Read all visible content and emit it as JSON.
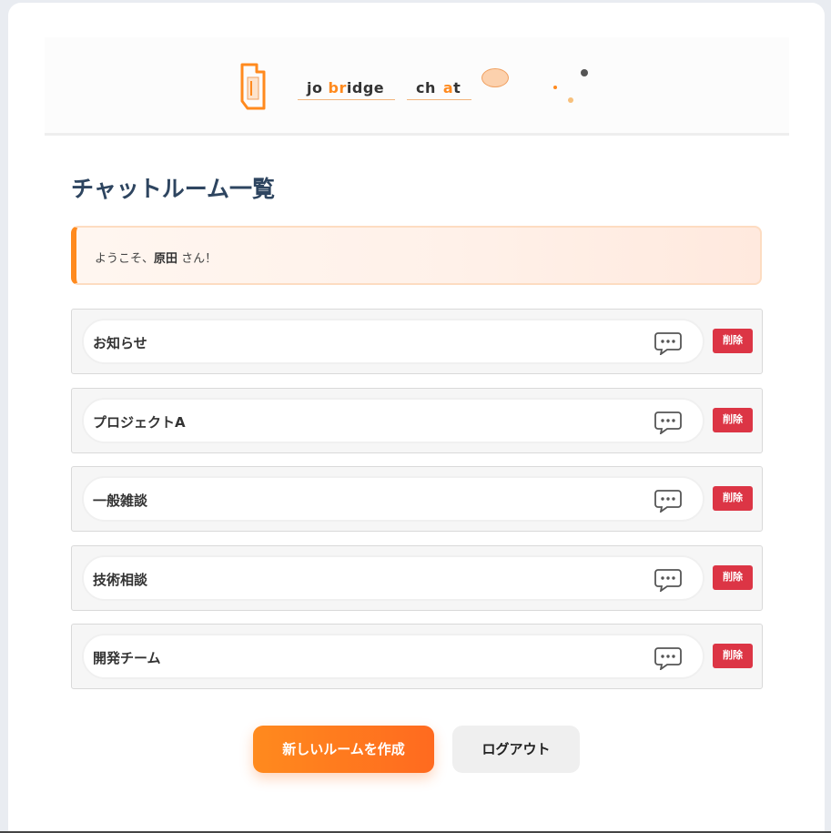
{
  "header": {
    "logo_parts": [
      "jo ",
      "br",
      "idge",
      "ch",
      "a",
      "t"
    ],
    "colors": {
      "accent": "#ff8a1e",
      "text": "#333333"
    }
  },
  "page_title": "チャットルーム一覧",
  "welcome": {
    "prefix": "ようこそ、",
    "user": "原田",
    "suffix": " さん！"
  },
  "rooms": [
    {
      "name": "お知らせ",
      "icon": "chat-bubble-icon",
      "delete_label": "削除"
    },
    {
      "name": "プロジェクトA",
      "icon": "chat-bubble-icon",
      "delete_label": "削除"
    },
    {
      "name": "一般雑談",
      "icon": "chat-bubble-icon",
      "delete_label": "削除"
    },
    {
      "name": "技術相談",
      "icon": "chat-bubble-icon",
      "delete_label": "削除"
    },
    {
      "name": "開発チーム",
      "icon": "chat-bubble-icon",
      "delete_label": "削除"
    }
  ],
  "actions": {
    "create_label": "新しいルームを作成",
    "logout_label": "ログアウト"
  },
  "colors": {
    "accent": "#ff8a1e",
    "danger": "#dc3545",
    "title": "#2e4560"
  }
}
